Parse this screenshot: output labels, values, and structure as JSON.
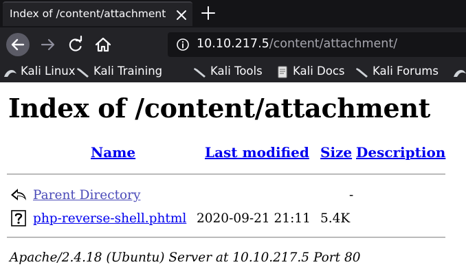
{
  "browser": {
    "tab": {
      "title": "Index of /content/attachment"
    },
    "url": {
      "host": "10.10.217.5",
      "path": "/content/attachment/"
    },
    "bookmarks": [
      {
        "label": "Kali Linux"
      },
      {
        "label": "Kali Training"
      },
      {
        "label": "Kali Tools"
      },
      {
        "label": "Kali Docs"
      },
      {
        "label": "Kali Forums"
      }
    ]
  },
  "page": {
    "heading": "Index of /content/attachment",
    "columns": {
      "name": "Name",
      "last_modified": "Last modified",
      "size": "Size",
      "description": "Description"
    },
    "rows": [
      {
        "icon": "back-arrow-icon",
        "name": "Parent Directory",
        "last_modified": "",
        "size": "-"
      },
      {
        "icon": "unknown-file-icon",
        "name": "php-reverse-shell.phtml",
        "last_modified": "2020-09-21 21:11",
        "size": "5.4K"
      }
    ],
    "footer": "Apache/2.4.18 (Ubuntu) Server at 10.10.217.5 Port 80"
  }
}
